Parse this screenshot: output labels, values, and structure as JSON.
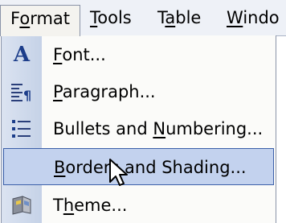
{
  "menubar": {
    "items": [
      {
        "pre": "F",
        "ul": "o",
        "post": "rmat"
      },
      {
        "pre": "",
        "ul": "T",
        "post": "ools"
      },
      {
        "pre": "T",
        "ul": "a",
        "post": "ble"
      },
      {
        "pre": "",
        "ul": "W",
        "post": "indo"
      }
    ]
  },
  "menu": {
    "items": [
      {
        "icon": "font-a-icon",
        "pre": "",
        "ul": "F",
        "post": "ont..."
      },
      {
        "icon": "paragraph-icon",
        "pre": "",
        "ul": "P",
        "post": "aragraph..."
      },
      {
        "icon": "bullets-icon",
        "pre": "Bullets and ",
        "ul": "N",
        "post": "umbering..."
      },
      {
        "icon": "",
        "pre": "",
        "ul": "B",
        "post": "orders and Shading..."
      },
      {
        "icon": "theme-icon",
        "pre": "T",
        "ul": "h",
        "post": "eme..."
      }
    ]
  },
  "colors": {
    "highlight": "#c3d2ee",
    "highlight_border": "#3b5fa8",
    "gutter": "#c5d2e7",
    "icon_blue": "#1c3d8a"
  }
}
